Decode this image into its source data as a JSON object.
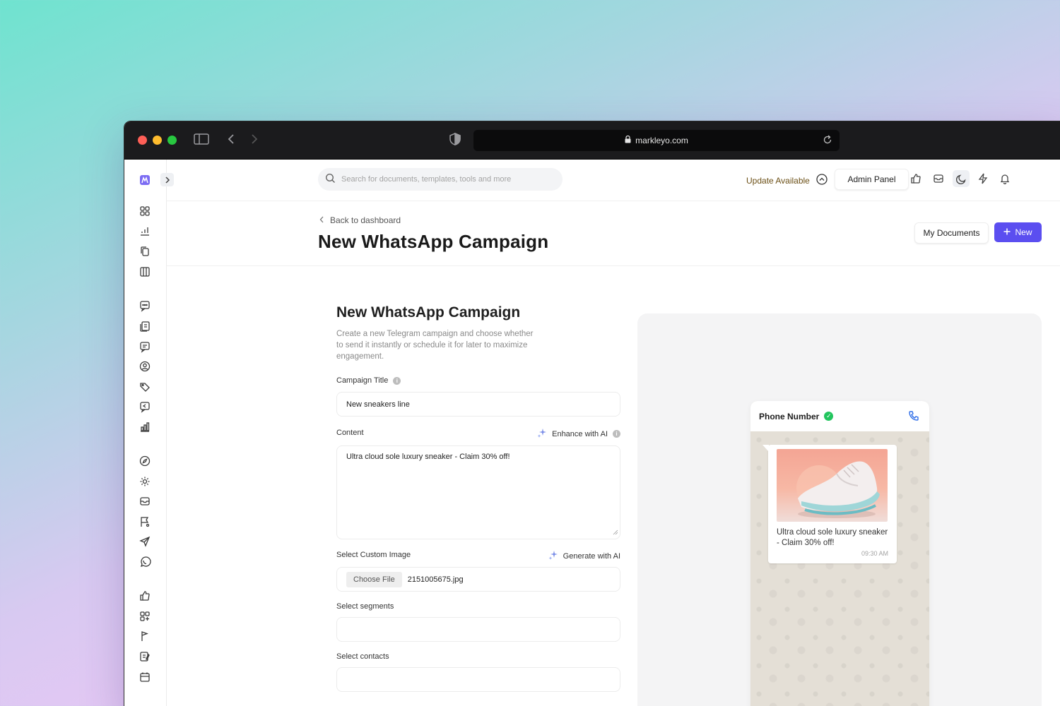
{
  "browser": {
    "url": "markleyo.com"
  },
  "topnav": {
    "search_placeholder": "Search for documents, templates, tools and more",
    "update_label": "Update Available",
    "admin_label": "Admin Panel"
  },
  "header": {
    "back_label": "Back to dashboard",
    "page_title": "New WhatsApp Campaign",
    "my_documents_label": "My Documents",
    "new_label": "New"
  },
  "form": {
    "title": "New WhatsApp Campaign",
    "description": "Create a new Telegram campaign and choose whether to send it instantly or schedule it for later to maximize engagement.",
    "campaign_title_label": "Campaign Title",
    "campaign_title_value": "New sneakers line",
    "content_label": "Content",
    "enhance_label": "Enhance with AI",
    "content_value": "Ultra cloud sole luxury sneaker - Claim 30% off!",
    "image_label": "Select Custom Image",
    "generate_label": "Generate with AI",
    "choose_file_label": "Choose File",
    "file_name": "2151005675.jpg",
    "segments_label": "Select segments",
    "contacts_label": "Select contacts"
  },
  "preview": {
    "header_title": "Phone Number",
    "message_text": "Ultra cloud sole luxury sneaker - Claim 30% off!",
    "message_time": "09:30 AM"
  },
  "colors": {
    "primary": "#5b4ef0",
    "verified": "#22c55e",
    "call_icon": "#2f6ee8",
    "update_text": "#6b4f15"
  },
  "sidebar_icons": [
    "grid-icon",
    "chart-pen-icon",
    "copy-icon",
    "board-icon",
    "chat-icon",
    "documents-icon",
    "message-icon",
    "user-circle-icon",
    "tags-icon",
    "reply-icon",
    "bar-chart-icon",
    "compass-icon",
    "settings-icon",
    "inbox-icon",
    "flag-settings-icon",
    "send-icon",
    "whatsapp-icon",
    "thumbs-up-icon",
    "apps-add-icon",
    "flag-icon",
    "notes-icon",
    "calendar-icon"
  ]
}
